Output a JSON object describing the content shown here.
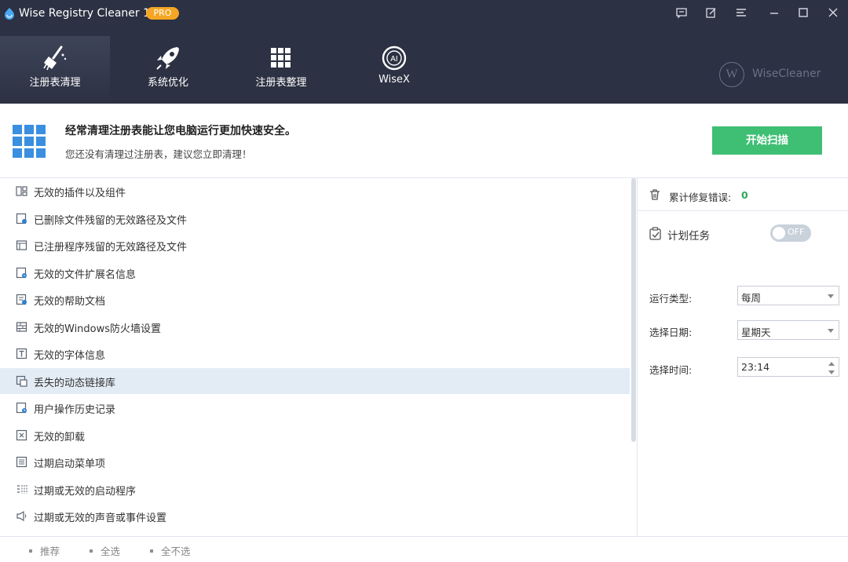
{
  "window": {
    "title": "Wise Registry Cleaner 11",
    "badge": "PRO",
    "controls": [
      "feedback-icon",
      "edit-icon",
      "menu-icon",
      "minimize-icon",
      "maximize-icon",
      "close-icon"
    ]
  },
  "nav": {
    "tabs": [
      {
        "label": "注册表清理",
        "icon": "broom-icon",
        "active": true
      },
      {
        "label": "系统优化",
        "icon": "rocket-icon",
        "active": false
      },
      {
        "label": "注册表整理",
        "icon": "grid-icon",
        "active": false
      },
      {
        "label": "WiseX",
        "icon": "ai-icon",
        "active": false
      }
    ],
    "brand": "WiseCleaner",
    "brand_letter": "W"
  },
  "banner": {
    "title": "经常清理注册表能让您电脑运行更加快速安全。",
    "subtitle": "您还没有清理过注册表，建议您立即清理！",
    "scan_button": "开始扫描"
  },
  "categories": [
    {
      "label": "无效的插件以及组件",
      "icon": "plugin-icon"
    },
    {
      "label": "已删除文件残留的无效路径及文件",
      "icon": "deleted-file-icon"
    },
    {
      "label": "已注册程序残留的无效路径及文件",
      "icon": "program-icon"
    },
    {
      "label": "无效的文件扩展名信息",
      "icon": "file-extension-icon"
    },
    {
      "label": "无效的帮助文档",
      "icon": "help-doc-icon"
    },
    {
      "label": "无效的Windows防火墙设置",
      "icon": "firewall-icon"
    },
    {
      "label": "无效的字体信息",
      "icon": "font-icon"
    },
    {
      "label": "丢失的动态链接库",
      "icon": "dll-icon",
      "selected": true
    },
    {
      "label": "用户操作历史记录",
      "icon": "history-icon"
    },
    {
      "label": "无效的卸载",
      "icon": "uninstall-icon"
    },
    {
      "label": "过期启动菜单项",
      "icon": "start-menu-icon"
    },
    {
      "label": "过期或无效的启动程序",
      "icon": "startup-icon"
    },
    {
      "label": "过期或无效的声音或事件设置",
      "icon": "sound-icon"
    }
  ],
  "stats": {
    "fixed_label": "累计修复错误:",
    "fixed_value": "0"
  },
  "schedule": {
    "label": "计划任务",
    "toggle_state": "OFF",
    "run_type_label": "运行类型:",
    "run_type_value": "每周",
    "date_label": "选择日期:",
    "date_value": "星期天",
    "time_label": "选择时间:",
    "time_value": "23:14"
  },
  "footer": {
    "recommend": "推荐",
    "select_all": "全选",
    "select_none": "全不选"
  },
  "colors": {
    "header_bg": "#2c3143",
    "accent_green": "#3fbf74",
    "badge_orange": "#f5a623",
    "selected_row": "#e3ecf5"
  }
}
